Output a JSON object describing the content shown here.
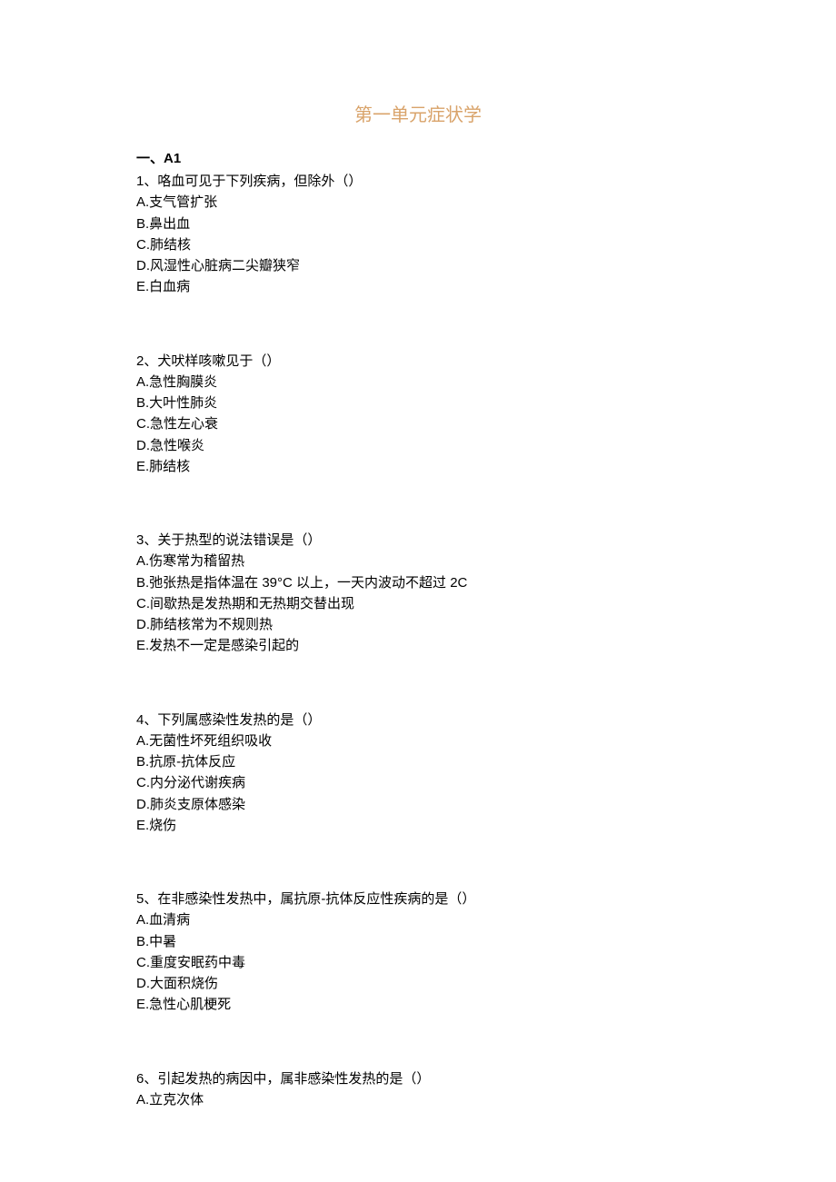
{
  "title": "第一单元症状学",
  "section_label": "一、A1",
  "questions": [
    {
      "number": "1、",
      "stem": "咯血可见于下列疾病，但除外（）",
      "options": [
        "A.支气管扩张",
        "B.鼻出血",
        "C.肺结核",
        "D.风湿性心脏病二尖瓣狭窄",
        "E.白血病"
      ]
    },
    {
      "number": "2、",
      "stem": "犬吠样咳嗽见于（）",
      "options": [
        "A.急性胸膜炎",
        "B.大叶性肺炎",
        "C.急性左心衰",
        "D.急性喉炎",
        "E.肺结核"
      ]
    },
    {
      "number": "3、",
      "stem": "关于热型的说法错误是（）",
      "options": [
        "A.伤寒常为稽留热",
        "B.弛张热是指体温在 39°C 以上，一天内波动不超过 2C",
        "C.间歇热是发热期和无热期交替出现",
        "D.肺结核常为不规则热",
        "E.发热不一定是感染引起的"
      ]
    },
    {
      "number": "4、",
      "stem": "下列属感染性发热的是（）",
      "options": [
        "A.无菌性坏死组织吸收",
        "B.抗原-抗体反应",
        "C.内分泌代谢疾病",
        "D.肺炎支原体感染",
        "E.烧伤"
      ]
    },
    {
      "number": "5、",
      "stem": "在非感染性发热中，属抗原-抗体反应性疾病的是（）",
      "options": [
        "A.血清病",
        "B.中暑",
        "C.重度安眠药中毒",
        "D.大面积烧伤",
        "E.急性心肌梗死"
      ]
    },
    {
      "number": "6、",
      "stem": "引起发热的病因中，属非感染性发热的是（）",
      "options": [
        "A.立克次体"
      ]
    }
  ]
}
